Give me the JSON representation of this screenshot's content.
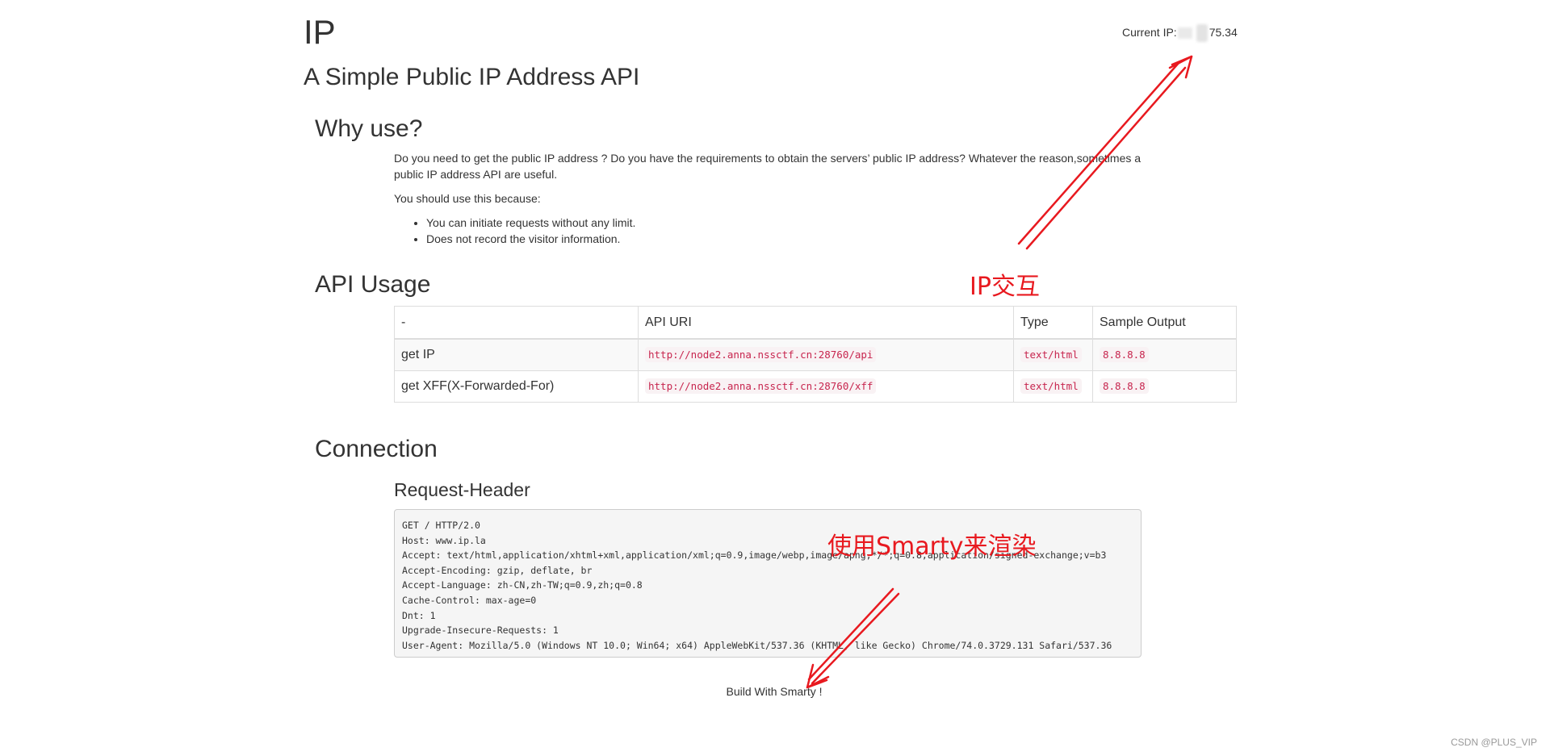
{
  "header": {
    "brand": "IP",
    "current_ip_label": "Current IP:",
    "current_ip_visible_part1": "",
    "current_ip_visible_part2": "75.34",
    "subtitle": "A Simple Public IP Address API"
  },
  "why": {
    "heading": "Why use?",
    "paragraph": "Do you need to get the public IP address ? Do you have the requirements to obtain the servers’ public IP address? Whatever the reason,sometimes a public IP address API are useful.",
    "lead": "You should use this because:",
    "bullets": [
      "You can initiate requests without any limit.",
      "Does not record the visitor information."
    ]
  },
  "usage": {
    "heading": "API Usage",
    "columns": [
      "-",
      "API URI",
      "Type",
      "Sample Output"
    ],
    "rows": [
      {
        "name": "get IP",
        "uri": "http://node2.anna.nssctf.cn:28760/api",
        "type": "text/html",
        "sample": "8.8.8.8"
      },
      {
        "name": "get XFF(X-Forwarded-For)",
        "uri": "http://node2.anna.nssctf.cn:28760/xff",
        "type": "text/html",
        "sample": "8.8.8.8"
      }
    ]
  },
  "connection": {
    "heading": "Connection",
    "request_header_title": "Request-Header",
    "request_lines": [
      "GET / HTTP/2.0",
      "Host: www.ip.la",
      "Accept: text/html,application/xhtml+xml,application/xml;q=0.9,image/webp,image/apng,*/*;q=0.8,application/signed-exchange;v=b3",
      "Accept-Encoding: gzip, deflate, br",
      "Accept-Language: zh-CN,zh-TW;q=0.9,zh;q=0.8",
      "Cache-Control: max-age=0",
      "Dnt: 1",
      "Upgrade-Insecure-Requests: 1",
      "User-Agent: Mozilla/5.0 (Windows NT 10.0; Win64; x64) AppleWebKit/537.36 (KHTML, like Gecko) Chrome/74.0.3729.131 Safari/537.36"
    ]
  },
  "footer": {
    "text": "Build With Smarty !"
  },
  "annotations": {
    "ip_interaction": "IP交互",
    "smarty_render": "使用Smarty来渲染",
    "color": "#e8191f"
  },
  "watermark": "CSDN @PLUS_VIP"
}
